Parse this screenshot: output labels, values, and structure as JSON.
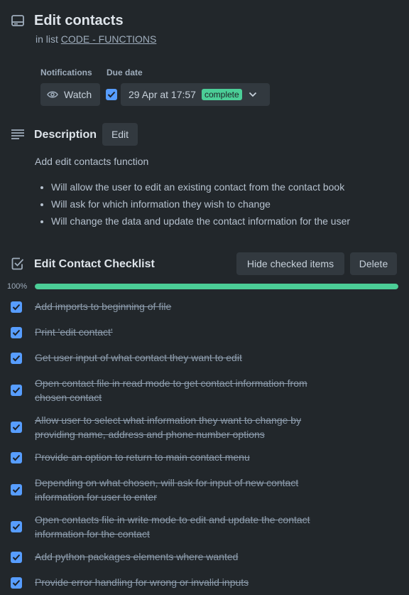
{
  "card": {
    "title": "Edit contacts",
    "in_list_prefix": "in list",
    "list_name": "CODE - FUNCTIONS"
  },
  "meta": {
    "notifications_label": "Notifications",
    "watch_label": "Watch",
    "due_date_label": "Due date",
    "due_date_value": "29 Apr at 17:57",
    "due_status": "complete",
    "due_checked": true
  },
  "description": {
    "heading": "Description",
    "edit_label": "Edit",
    "text": "Add edit contacts function",
    "bullets": [
      "Will allow the user to edit an existing contact from the contact book",
      "Will ask for which information they wish to change",
      "Will change the data and update the contact information for the user"
    ]
  },
  "checklist": {
    "title": "Edit Contact Checklist",
    "hide_checked_label": "Hide checked items",
    "delete_label": "Delete",
    "progress_label": "100%",
    "progress": 1.0,
    "items": [
      {
        "lines": [
          "Add imports to beginning of file"
        ],
        "checked": true
      },
      {
        "lines": [
          "Print 'edit contact'"
        ],
        "checked": true
      },
      {
        "lines": [
          "Get user input of what contact they want to edit"
        ],
        "checked": true
      },
      {
        "lines": [
          "Open contact file in read mode to get contact information from",
          "chosen contact"
        ],
        "checked": true
      },
      {
        "lines": [
          "Allow user to select what information they want to change by",
          "providing name, address and phone number options"
        ],
        "checked": true
      },
      {
        "lines": [
          "Provide an option to return to main contact menu"
        ],
        "checked": true
      },
      {
        "lines": [
          "Depending on what chosen, will ask for input of new contact",
          "information for user to enter"
        ],
        "checked": true
      },
      {
        "lines": [
          "Open contacts file in write mode to edit and update the contact",
          "information for the contact"
        ],
        "checked": true
      },
      {
        "lines": [
          "Add python packages elements where wanted"
        ],
        "checked": true
      },
      {
        "lines": [
          "Provide error handling for wrong or invalid inputs"
        ],
        "checked": true
      }
    ]
  },
  "icons": {
    "card": "card-icon",
    "watch": "eye-icon",
    "description": "description-lines-icon",
    "checklist": "checklist-icon",
    "chevron": "chevron-down-icon",
    "check": "check-icon"
  },
  "colors": {
    "background": "#22272b",
    "button": "#32393f",
    "checkbox": "#579dff",
    "complete": "#4bce97"
  }
}
